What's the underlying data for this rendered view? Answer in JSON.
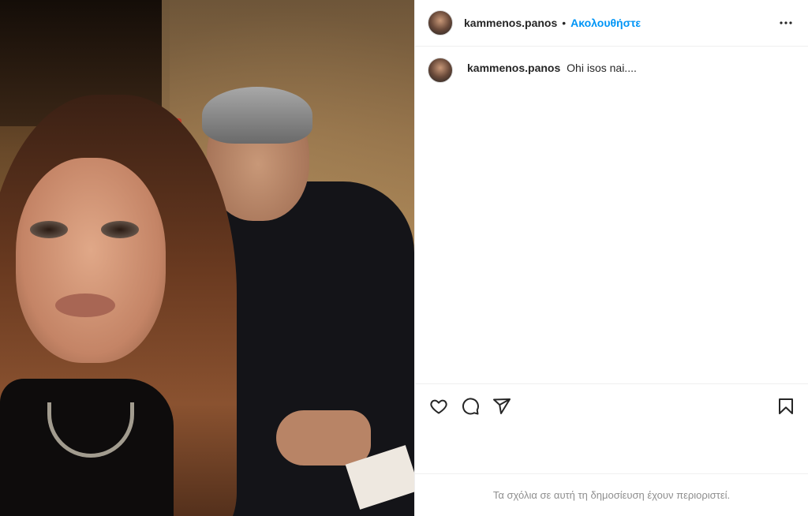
{
  "post": {
    "media_alt": "Selfie photo of a woman and a man",
    "author": {
      "username": "kammenos.panos",
      "avatar_icon": "profile-avatar"
    },
    "header": {
      "separator": "•",
      "follow_label": "Ακολουθήστε",
      "more_icon": "more-horizontal-icon"
    },
    "caption": {
      "username": "kammenos.panos",
      "text": "Ohi isos nai...."
    },
    "actions": {
      "like_icon": "heart-icon",
      "comment_icon": "comment-icon",
      "share_icon": "share-icon",
      "save_icon": "bookmark-icon"
    },
    "comments_notice": "Τα σχόλια σε αυτή τη δημοσίευση έχουν περιοριστεί."
  },
  "colors": {
    "accent": "#0095f6",
    "text": "#262626",
    "muted": "#8e8e8e",
    "border": "#efefef"
  }
}
